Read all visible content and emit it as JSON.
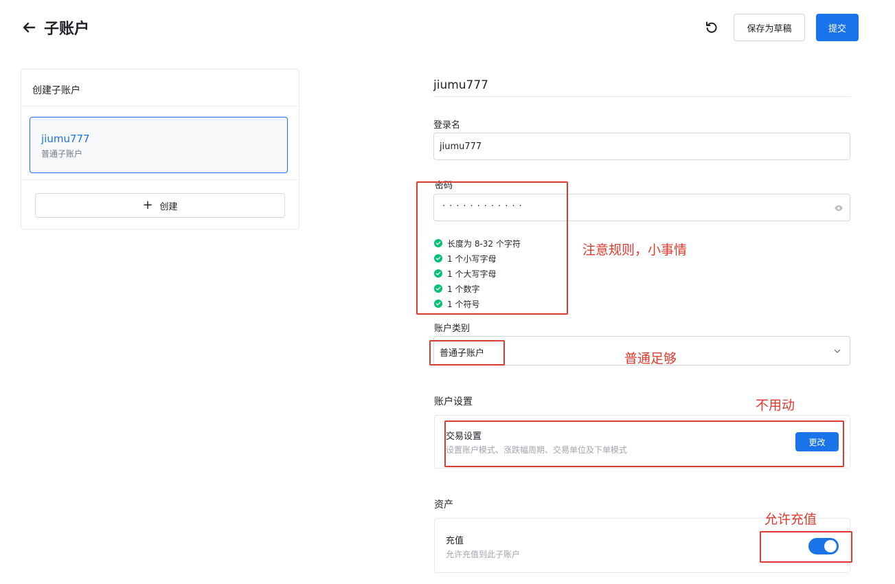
{
  "header": {
    "back_icon": "arrow-left-icon",
    "title": "子账户",
    "refresh_icon": "refresh-icon",
    "save_draft_label": "保存为草稿",
    "submit_label": "提交"
  },
  "sidebar": {
    "heading": "创建子账户",
    "selected_account": {
      "name": "jiumu777",
      "type": "普通子账户"
    },
    "create_label": "创建",
    "create_icon": "plus-icon"
  },
  "form": {
    "heading": "jiumu777",
    "login_name": {
      "label": "登录名",
      "value": "jiumu777"
    },
    "password": {
      "label": "密码",
      "masked_value": "············",
      "eye_icon": "eye-icon",
      "rules": [
        "长度为 8-32 个字符",
        "1 个小写字母",
        "1 个大写字母",
        "1 个数字",
        "1 个符号"
      ]
    },
    "account_type": {
      "label": "账户类别",
      "value": "普通子账户"
    },
    "account_settings": {
      "section_label": "账户设置",
      "trade": {
        "title": "交易设置",
        "desc": "设置账户模式、涨跌幅周期、交易单位及下单模式",
        "button_label": "更改"
      }
    },
    "assets": {
      "section_label": "资产",
      "deposit": {
        "title": "充值",
        "desc": "允许充值到此子账户",
        "enabled": true
      }
    }
  },
  "annotations": {
    "password_note": "注意规则，小事情",
    "type_note": "普通足够",
    "settings_note": "不用动",
    "deposit_note": "允许充值"
  },
  "colors": {
    "primary": "#1a73e8",
    "success": "#02c076",
    "annotation": "#e03a2f"
  }
}
